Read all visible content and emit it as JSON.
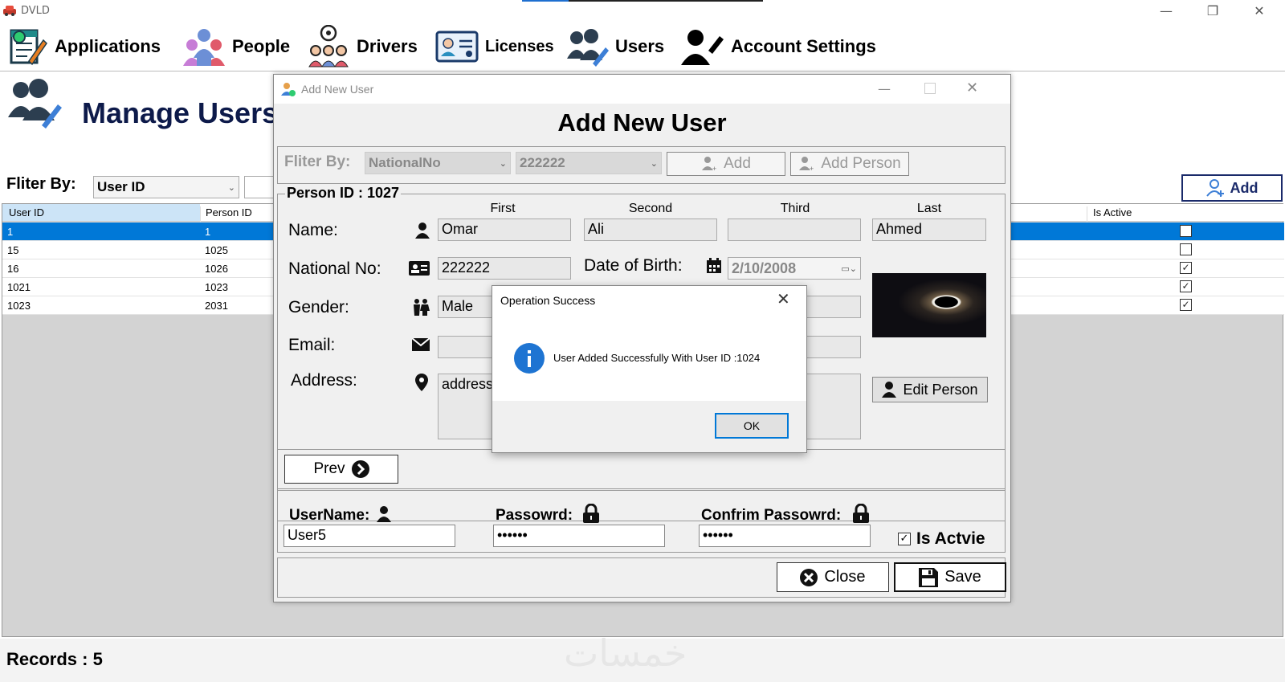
{
  "window": {
    "title": "DVLD"
  },
  "menu": [
    {
      "label": "Applications",
      "icon": "applications-icon"
    },
    {
      "label": "People",
      "icon": "people-icon"
    },
    {
      "label": "Drivers",
      "icon": "drivers-icon"
    },
    {
      "label": "Licenses",
      "icon": "licenses-icon"
    },
    {
      "label": "Users",
      "icon": "users-icon"
    },
    {
      "label": "Account Settings",
      "icon": "account-settings-icon"
    }
  ],
  "manage": {
    "title": "Manage Users",
    "filter_label": "Fliter By:",
    "filter_value": "User ID",
    "add_label": "Add",
    "columns": [
      "User ID",
      "Person ID",
      "Is Active"
    ],
    "rows": [
      {
        "user_id": "1",
        "person_id": "1",
        "is_active": false,
        "selected": true
      },
      {
        "user_id": "15",
        "person_id": "1025",
        "is_active": false
      },
      {
        "user_id": "16",
        "person_id": "1026",
        "is_active": true
      },
      {
        "user_id": "1021",
        "person_id": "1023",
        "is_active": true
      },
      {
        "user_id": "1023",
        "person_id": "2031",
        "is_active": true
      }
    ],
    "records": "Records : 5",
    "watermark": "خمسات"
  },
  "dialog": {
    "window_title": "Add New User",
    "heading": "Add New User",
    "filter_label": "Fliter By:",
    "filter_field": "NationalNo",
    "filter_value": "222222",
    "add_label": "Add",
    "add_person_label": "Add Person",
    "person_id": "Person ID : 1027",
    "col_first": "First",
    "col_second": "Second",
    "col_third": "Third",
    "col_last": "Last",
    "name_label": "Name:",
    "first": "Omar",
    "second": "Ali",
    "third": "",
    "last": "Ahmed",
    "national_label": "National No:",
    "national_no": "222222",
    "dob_label": "Date of Birth:",
    "dob": "2/10/2008",
    "gender_label": "Gender:",
    "gender": "Male",
    "email_label": "Email:",
    "email": "",
    "address_label": "Address:",
    "address": "address",
    "edit_person_label": "Edit Person",
    "prev_label": "Prev",
    "username_label": "UserName:",
    "username": "User5",
    "password_label": "Passowrd:",
    "password": "••••••",
    "confirm_label": "Confrim Passowrd:",
    "confirm": "••••••",
    "is_active_label": "Is Actvie",
    "is_active": true,
    "close_label": "Close",
    "save_label": "Save"
  },
  "message": {
    "title": "Operation Success",
    "text": "User Added Successfully With User ID :1024",
    "ok_label": "OK"
  }
}
